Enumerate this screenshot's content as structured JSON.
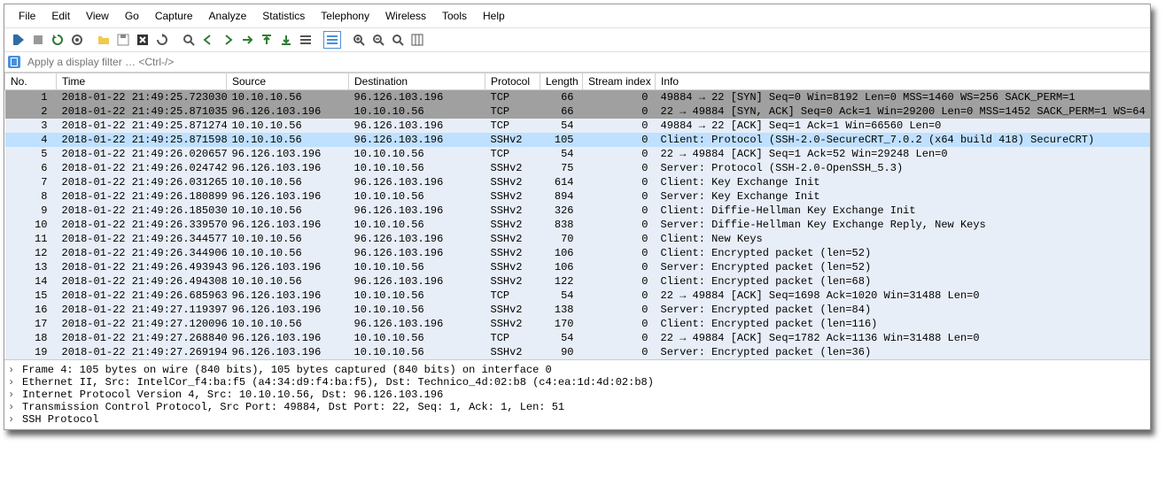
{
  "menu": [
    "File",
    "Edit",
    "View",
    "Go",
    "Capture",
    "Analyze",
    "Statistics",
    "Telephony",
    "Wireless",
    "Tools",
    "Help"
  ],
  "filter": {
    "placeholder": "Apply a display filter … <Ctrl-/>"
  },
  "columns": [
    "No.",
    "Time",
    "Source",
    "Destination",
    "Protocol",
    "Length",
    "Stream index",
    "Info"
  ],
  "packets": [
    {
      "no": 1,
      "time": "2018-01-22 21:49:25.723030",
      "src": "10.10.10.56",
      "dst": "96.126.103.196",
      "proto": "TCP",
      "len": 66,
      "si": 0,
      "info": "49884 → 22 [SYN] Seq=0 Win=8192 Len=0 MSS=1460 WS=256 SACK_PERM=1",
      "cls": "row-dark"
    },
    {
      "no": 2,
      "time": "2018-01-22 21:49:25.871035",
      "src": "96.126.103.196",
      "dst": "10.10.10.56",
      "proto": "TCP",
      "len": 66,
      "si": 0,
      "info": "22 → 49884 [SYN, ACK] Seq=0 Ack=1 Win=29200 Len=0 MSS=1452 SACK_PERM=1 WS=64",
      "cls": "row-dark"
    },
    {
      "no": 3,
      "time": "2018-01-22 21:49:25.871274",
      "src": "10.10.10.56",
      "dst": "96.126.103.196",
      "proto": "TCP",
      "len": 54,
      "si": 0,
      "info": "49884 → 22 [ACK] Seq=1 Ack=1 Win=66560 Len=0",
      "cls": "row-norm"
    },
    {
      "no": 4,
      "time": "2018-01-22 21:49:25.871598",
      "src": "10.10.10.56",
      "dst": "96.126.103.196",
      "proto": "SSHv2",
      "len": 105,
      "si": 0,
      "info": "Client: Protocol (SSH-2.0-SecureCRT_7.0.2 (x64 build 418) SecureCRT)",
      "cls": "row-sel"
    },
    {
      "no": 5,
      "time": "2018-01-22 21:49:26.020657",
      "src": "96.126.103.196",
      "dst": "10.10.10.56",
      "proto": "TCP",
      "len": 54,
      "si": 0,
      "info": "22 → 49884 [ACK] Seq=1 Ack=52 Win=29248 Len=0",
      "cls": "row-norm"
    },
    {
      "no": 6,
      "time": "2018-01-22 21:49:26.024742",
      "src": "96.126.103.196",
      "dst": "10.10.10.56",
      "proto": "SSHv2",
      "len": 75,
      "si": 0,
      "info": "Server: Protocol (SSH-2.0-OpenSSH_5.3)",
      "cls": "row-norm"
    },
    {
      "no": 7,
      "time": "2018-01-22 21:49:26.031265",
      "src": "10.10.10.56",
      "dst": "96.126.103.196",
      "proto": "SSHv2",
      "len": 614,
      "si": 0,
      "info": "Client: Key Exchange Init",
      "cls": "row-norm"
    },
    {
      "no": 8,
      "time": "2018-01-22 21:49:26.180899",
      "src": "96.126.103.196",
      "dst": "10.10.10.56",
      "proto": "SSHv2",
      "len": 894,
      "si": 0,
      "info": "Server: Key Exchange Init",
      "cls": "row-norm"
    },
    {
      "no": 9,
      "time": "2018-01-22 21:49:26.185030",
      "src": "10.10.10.56",
      "dst": "96.126.103.196",
      "proto": "SSHv2",
      "len": 326,
      "si": 0,
      "info": "Client: Diffie-Hellman Key Exchange Init",
      "cls": "row-norm"
    },
    {
      "no": 10,
      "time": "2018-01-22 21:49:26.339570",
      "src": "96.126.103.196",
      "dst": "10.10.10.56",
      "proto": "SSHv2",
      "len": 838,
      "si": 0,
      "info": "Server: Diffie-Hellman Key Exchange Reply, New Keys",
      "cls": "row-norm"
    },
    {
      "no": 11,
      "time": "2018-01-22 21:49:26.344577",
      "src": "10.10.10.56",
      "dst": "96.126.103.196",
      "proto": "SSHv2",
      "len": 70,
      "si": 0,
      "info": "Client: New Keys",
      "cls": "row-norm"
    },
    {
      "no": 12,
      "time": "2018-01-22 21:49:26.344906",
      "src": "10.10.10.56",
      "dst": "96.126.103.196",
      "proto": "SSHv2",
      "len": 106,
      "si": 0,
      "info": "Client: Encrypted packet (len=52)",
      "cls": "row-norm"
    },
    {
      "no": 13,
      "time": "2018-01-22 21:49:26.493943",
      "src": "96.126.103.196",
      "dst": "10.10.10.56",
      "proto": "SSHv2",
      "len": 106,
      "si": 0,
      "info": "Server: Encrypted packet (len=52)",
      "cls": "row-norm"
    },
    {
      "no": 14,
      "time": "2018-01-22 21:49:26.494308",
      "src": "10.10.10.56",
      "dst": "96.126.103.196",
      "proto": "SSHv2",
      "len": 122,
      "si": 0,
      "info": "Client: Encrypted packet (len=68)",
      "cls": "row-norm"
    },
    {
      "no": 15,
      "time": "2018-01-22 21:49:26.685963",
      "src": "96.126.103.196",
      "dst": "10.10.10.56",
      "proto": "TCP",
      "len": 54,
      "si": 0,
      "info": "22 → 49884 [ACK] Seq=1698 Ack=1020 Win=31488 Len=0",
      "cls": "row-norm"
    },
    {
      "no": 16,
      "time": "2018-01-22 21:49:27.119397",
      "src": "96.126.103.196",
      "dst": "10.10.10.56",
      "proto": "SSHv2",
      "len": 138,
      "si": 0,
      "info": "Server: Encrypted packet (len=84)",
      "cls": "row-norm"
    },
    {
      "no": 17,
      "time": "2018-01-22 21:49:27.120096",
      "src": "10.10.10.56",
      "dst": "96.126.103.196",
      "proto": "SSHv2",
      "len": 170,
      "si": 0,
      "info": "Client: Encrypted packet (len=116)",
      "cls": "row-norm"
    },
    {
      "no": 18,
      "time": "2018-01-22 21:49:27.268840",
      "src": "96.126.103.196",
      "dst": "10.10.10.56",
      "proto": "TCP",
      "len": 54,
      "si": 0,
      "info": "22 → 49884 [ACK] Seq=1782 Ack=1136 Win=31488 Len=0",
      "cls": "row-norm"
    },
    {
      "no": 19,
      "time": "2018-01-22 21:49:27.269194",
      "src": "96.126.103.196",
      "dst": "10.10.10.56",
      "proto": "SSHv2",
      "len": 90,
      "si": 0,
      "info": "Server: Encrypted packet (len=36)",
      "cls": "row-norm"
    }
  ],
  "details": [
    "Frame 4: 105 bytes on wire (840 bits), 105 bytes captured (840 bits) on interface 0",
    "Ethernet II, Src: IntelCor_f4:ba:f5 (a4:34:d9:f4:ba:f5), Dst: Technico_4d:02:b8 (c4:ea:1d:4d:02:b8)",
    "Internet Protocol Version 4, Src: 10.10.10.56, Dst: 96.126.103.196",
    "Transmission Control Protocol, Src Port: 49884, Dst Port: 22, Seq: 1, Ack: 1, Len: 51",
    "SSH Protocol"
  ]
}
